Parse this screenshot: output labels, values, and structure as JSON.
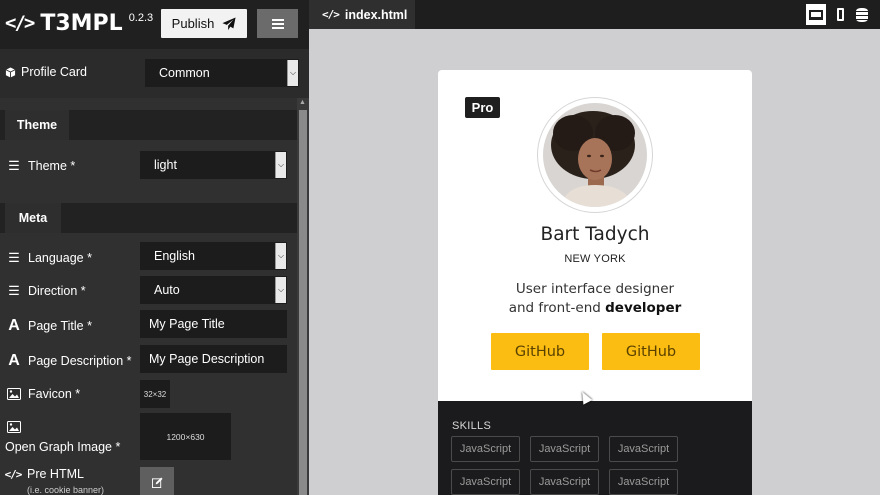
{
  "app": {
    "icon": "</>",
    "name": "T3MPL",
    "version": "0.2.3"
  },
  "toolbar": {
    "publish_label": "Publish",
    "publish_icon": "paper-plane-icon",
    "menu_icon": "hamburger-icon"
  },
  "template": {
    "icon": "cube-icon",
    "label": "Profile Card",
    "value": "Common"
  },
  "sections": {
    "theme": {
      "tab": "Theme",
      "fields": [
        {
          "icon": "list-icon",
          "label": "Theme *",
          "value": "light"
        }
      ]
    },
    "meta": {
      "tab": "Meta",
      "language": {
        "icon": "list-icon",
        "label": "Language *",
        "value": "English"
      },
      "direction": {
        "icon": "list-icon",
        "label": "Direction *",
        "value": "Auto"
      },
      "page_title": {
        "icon": "text-icon",
        "label": "Page Title *",
        "value": "My Page Title"
      },
      "page_description": {
        "icon": "text-icon",
        "label": "Page Description *",
        "value": "My Page Description"
      },
      "favicon": {
        "icon": "image-icon",
        "label": "Favicon *",
        "placeholder": "32×32"
      },
      "og_image": {
        "icon": "image-icon",
        "label": "Open Graph Image *",
        "placeholder": "1200×630"
      },
      "pre_html": {
        "icon": "code-icon",
        "label": "Pre HTML",
        "hint": "(i.e. cookie banner)",
        "button_icon": "edit-icon"
      }
    }
  },
  "editor": {
    "tab_label": "index.html",
    "devices": [
      "desktop-icon",
      "mobile-icon",
      "database-icon"
    ]
  },
  "preview": {
    "badge": "Pro",
    "name": "Bart Tadych",
    "city": "NEW YORK",
    "bio_line1": "User interface designer",
    "bio_line2_prefix": "and front-end ",
    "bio_line2_bold": "developer",
    "buttons": [
      "GitHub",
      "GitHub"
    ],
    "skills_title": "SKILLS",
    "skills": [
      "JavaScript",
      "JavaScript",
      "JavaScript",
      "JavaScript",
      "JavaScript",
      "JavaScript"
    ]
  },
  "colors": {
    "accent": "#fbbd12",
    "panel": "#303030",
    "dark": "#1b1b1d"
  }
}
